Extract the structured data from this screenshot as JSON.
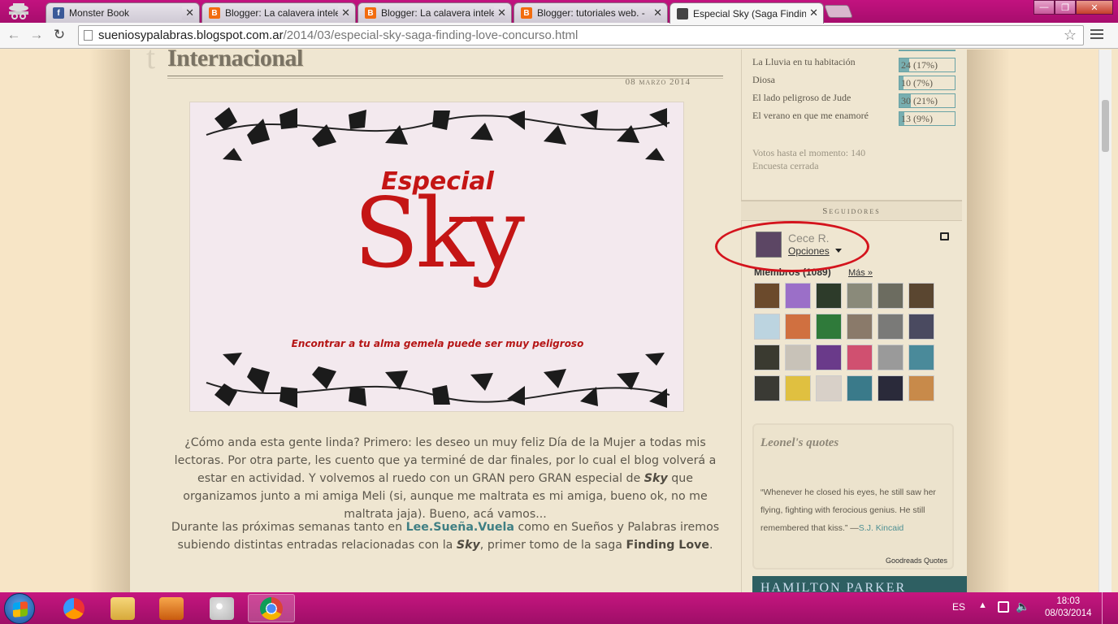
{
  "browser": {
    "tabs": [
      {
        "title": "Monster Book",
        "favicon": "facebook-icon",
        "color": "#3b5998"
      },
      {
        "title": "Blogger: La calavera intele",
        "favicon": "blogger-icon",
        "color": "#f26c0f"
      },
      {
        "title": "Blogger: La calavera intele",
        "favicon": "blogger-icon",
        "color": "#f26c0f"
      },
      {
        "title": "Blogger: tutoriales web. - ",
        "favicon": "blogger-icon",
        "color": "#f26c0f"
      },
      {
        "title": "Especial Sky (Saga Finding",
        "favicon": "page-icon",
        "color": "#444444"
      }
    ],
    "close_glyph": "✕",
    "url_host": "sueniosypalabras.blogspot.com.ar",
    "url_path": "/2014/03/especial-sky-saga-finding-love-concurso.html",
    "window_buttons": {
      "minimize": "—",
      "maximize": "❐",
      "close": "✕"
    }
  },
  "post": {
    "title": "Internacional",
    "date": "08 marzo 2014",
    "banner": {
      "especial": "Especial",
      "sky": "Sky",
      "tagline": "Encontrar a tu alma gemela puede ser muy peligroso"
    },
    "paragraph1": {
      "a": "¿Cómo anda esta gente linda? Primero: les deseo un muy feliz Día de la Mujer a todas mis lectoras. Por otra parte, les cuento que ya terminé de dar finales, por lo cual el blog volverá a estar en actividad. Y volvemos al ruedo con un GRAN pero GRAN especial de ",
      "b": "Sky",
      "c": " que organizamos junto a mi amiga Meli (si, aunque me maltrata es mi amiga, bueno ok, no me maltrata jaja). Bueno, acá vamos..."
    },
    "paragraph2": {
      "a": "Durante las próximas semanas tanto en ",
      "link": "Lee.Sueña.Vuela",
      "b": " como en Sueños y Palabras iremos subiendo distintas entradas relacionadas con la ",
      "sky": "Sky",
      "c": ", primer tomo de la saga ",
      "saga": "Finding Love",
      "d": "."
    }
  },
  "sidebar": {
    "poll": [
      {
        "label": "La Lluvia en tu habitación",
        "value": "24 (17%)",
        "pct": 17
      },
      {
        "label": "Diosa",
        "value": "10 (7%)",
        "pct": 7
      },
      {
        "label": "El lado peligroso de Jude",
        "value": "30 (21%)",
        "pct": 21
      },
      {
        "label": "El verano en que me enamoré",
        "value": "13 (9%)",
        "pct": 9
      }
    ],
    "votes_total": "Votos hasta el momento: 140",
    "poll_status": "Encuesta cerrada",
    "followers_heading": "Seguidores",
    "user_name": "Cece R.",
    "user_options": "Opciones",
    "members": "Miembros (1089)",
    "more": "Más »",
    "member_colors": [
      "#6b4a2c",
      "#9b6fc8",
      "#2d3b2a",
      "#8a8a7a",
      "#6c6c60",
      "#5a4630",
      "#bcd4e0",
      "#d07040",
      "#2f7a3a",
      "#8a7a6a",
      "#7a7a78",
      "#4a4a60",
      "#3a3a30",
      "#c8c2b8",
      "#6a3a8a",
      "#d05070",
      "#9a9a9a",
      "#4a8a9a",
      "#3a3a34",
      "#e0c040",
      "#d8d0c8",
      "#3a7a8a",
      "#2a2a3a",
      "#c88a4a"
    ],
    "quotes_title": "Leonel's quotes",
    "quote_text": "“Whenever he closed his eyes, he still saw her flying, fighting with ferocious genius. He still remembered that kiss.” —",
    "quote_author": "S.J. Kincaid",
    "quotes_footer": "Goodreads Quotes",
    "ad_text": "HAMILTON PARKER"
  },
  "taskbar": {
    "language": "ES",
    "time": "18:03",
    "date": "08/03/2014"
  }
}
